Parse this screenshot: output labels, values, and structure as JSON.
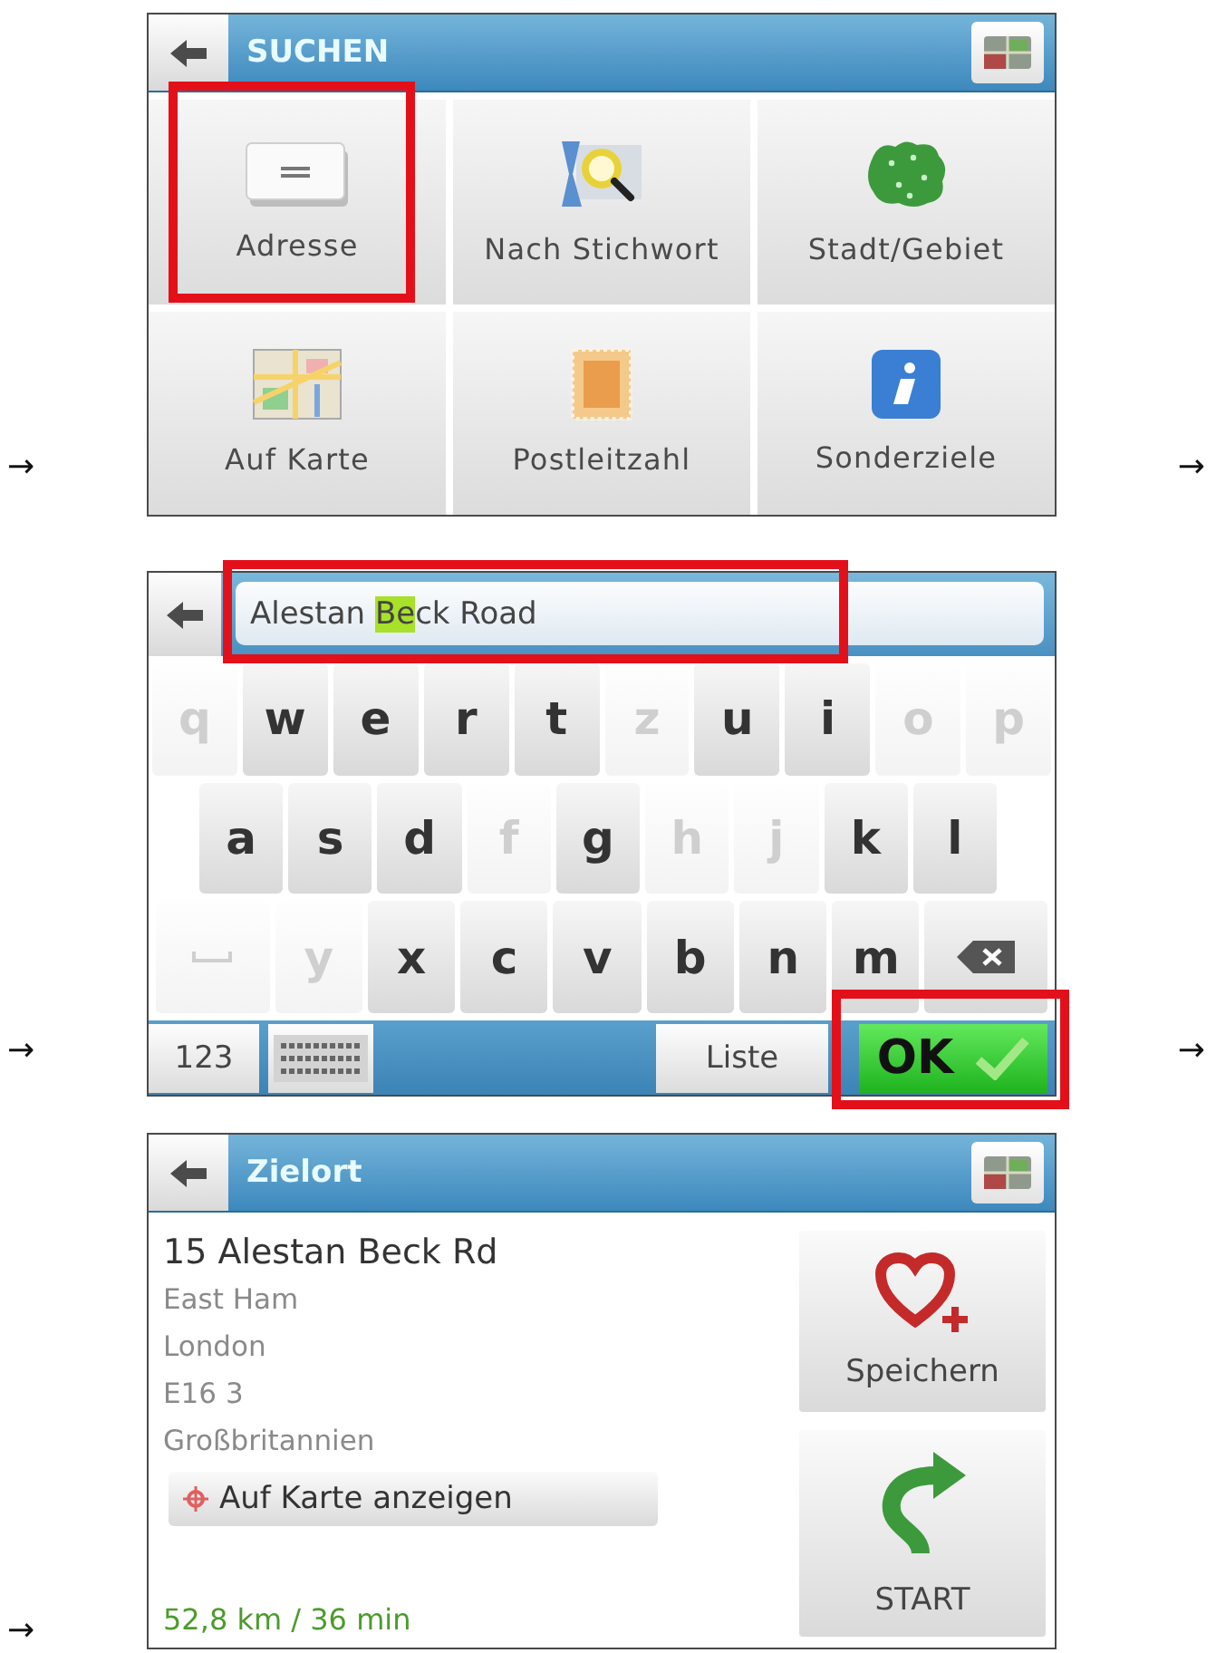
{
  "screens": [
    {
      "kind": "menu",
      "arrow_left": "→",
      "arrow_right": "→",
      "header": {
        "title": "SUCHEN"
      },
      "tiles": [
        {
          "label": "Adresse",
          "highlighted": true
        },
        {
          "label": "Nach Stichwort",
          "highlighted": false
        },
        {
          "label": "Stadt/Gebiet",
          "highlighted": false
        },
        {
          "label": "Auf Karte",
          "highlighted": false
        },
        {
          "label": "Postleitzahl",
          "highlighted": false
        },
        {
          "label": "Sonderziele",
          "highlighted": false
        }
      ]
    },
    {
      "kind": "keyboard",
      "arrow_left": "→",
      "arrow_right": "→",
      "input": {
        "segments": [
          {
            "text": "Alestan ",
            "matched": false
          },
          {
            "text": "Be",
            "matched": true
          },
          {
            "text": "ck Road",
            "matched": false
          }
        ],
        "highlighted": true
      },
      "key_rows": [
        [
          {
            "kind": "letter",
            "label": "q",
            "disabled": true
          },
          {
            "kind": "letter",
            "label": "w",
            "disabled": false
          },
          {
            "kind": "letter",
            "label": "e",
            "disabled": false
          },
          {
            "kind": "letter",
            "label": "r",
            "disabled": false
          },
          {
            "kind": "letter",
            "label": "t",
            "disabled": false
          },
          {
            "kind": "letter",
            "label": "z",
            "disabled": true
          },
          {
            "kind": "letter",
            "label": "u",
            "disabled": false
          },
          {
            "kind": "letter",
            "label": "i",
            "disabled": false
          },
          {
            "kind": "letter",
            "label": "o",
            "disabled": true
          },
          {
            "kind": "letter",
            "label": "p",
            "disabled": true
          }
        ],
        [
          {
            "kind": "letter",
            "label": "a",
            "disabled": false
          },
          {
            "kind": "letter",
            "label": "s",
            "disabled": false
          },
          {
            "kind": "letter",
            "label": "d",
            "disabled": false
          },
          {
            "kind": "letter",
            "label": "f",
            "disabled": true
          },
          {
            "kind": "letter",
            "label": "g",
            "disabled": false
          },
          {
            "kind": "letter",
            "label": "h",
            "disabled": true
          },
          {
            "kind": "letter",
            "label": "j",
            "disabled": true
          },
          {
            "kind": "letter",
            "label": "k",
            "disabled": false
          },
          {
            "kind": "letter",
            "label": "l",
            "disabled": false
          }
        ],
        [
          {
            "kind": "space",
            "disabled": true
          },
          {
            "kind": "letter",
            "label": "y",
            "disabled": true
          },
          {
            "kind": "letter",
            "label": "x",
            "disabled": false
          },
          {
            "kind": "letter",
            "label": "c",
            "disabled": false
          },
          {
            "kind": "letter",
            "label": "v",
            "disabled": false
          },
          {
            "kind": "letter",
            "label": "b",
            "disabled": false
          },
          {
            "kind": "letter",
            "label": "n",
            "disabled": false
          },
          {
            "kind": "letter",
            "label": "m",
            "disabled": false
          },
          {
            "kind": "backspace",
            "disabled": false
          }
        ]
      ],
      "bottom": {
        "numbers_key": "123",
        "list_button": "Liste",
        "ok_button": {
          "label": "OK",
          "highlighted": true
        }
      }
    },
    {
      "kind": "destination",
      "arrow_left": "→",
      "header": {
        "title": "Zielort"
      },
      "address": {
        "street": "15 Alestan Beck Rd",
        "lines": [
          "East Ham",
          "London",
          "E16 3",
          "Großbritannien"
        ]
      },
      "map_button": "Auf Karte anzeigen",
      "distance": "52,8 km / 36 min",
      "save_button": "Speichern",
      "start_button": "START"
    }
  ]
}
